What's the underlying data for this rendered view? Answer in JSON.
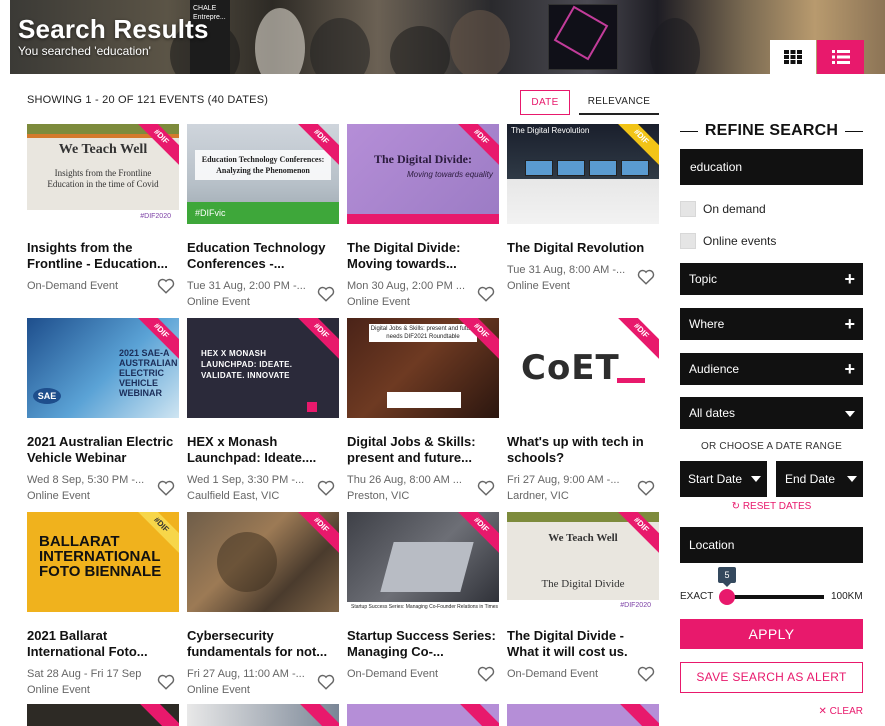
{
  "hero": {
    "title": "Search Results",
    "subtitle": "You searched 'education'",
    "sign_text": "CHALE Entrepre...",
    "view_grid_icon": "grid-icon",
    "view_list_icon": "list-icon"
  },
  "results": {
    "showing": "SHOWING 1 - 20 OF 121 EVENTS (40 DATES)",
    "sort_date": "DATE",
    "sort_relevance": "RELEVANCE"
  },
  "events": [
    {
      "title": "Insights from the Frontline - Education...",
      "meta1": "On-Demand Event",
      "meta2": "",
      "ribbon": "#DIF",
      "thumb_h1": "We Teach Well",
      "thumb_h2": "Insights from the Frontline Education in the time of Covid",
      "thumb_foot": "#DIF2020"
    },
    {
      "title": "Education Technology Conferences -...",
      "meta1": "Tue 31 Aug, 2:00 PM -...",
      "meta2": "Online Event",
      "ribbon": "#DIF",
      "thumb_h1": "Education Technology Conferences: Analyzing the Phenomenon",
      "thumb_foot": "#DIFvic"
    },
    {
      "title": "The Digital Divide: Moving towards...",
      "meta1": "Mon 30 Aug, 2:00 PM ...",
      "meta2": "Online Event",
      "ribbon": "#DIF",
      "thumb_h1": "The Digital Divide:",
      "thumb_h2": "Moving towards equality"
    },
    {
      "title": "The Digital Revolution",
      "meta1": "Tue 31 Aug, 8:00 AM -...",
      "meta2": "Online Event",
      "ribbon": "#DIF",
      "thumb_h1": "The Digital Revolution"
    },
    {
      "title": "2021 Australian Electric Vehicle Webinar",
      "meta1": "Wed 8 Sep, 5:30 PM -...",
      "meta2": "Online Event",
      "ribbon": "#DIF",
      "thumb_h1": "2021 SAE-A AUSTRALIAN ELECTRIC VEHICLE WEBINAR"
    },
    {
      "title": "HEX x Monash Launchpad: Ideate....",
      "meta1": "Wed 1 Sep, 3:30 PM -...",
      "meta2": "Caulfield East, VIC",
      "ribbon": "#DIF",
      "thumb_h1": "HEX X MONASH LAUNCHPAD: IDEATE. VALIDATE. INNOVATE"
    },
    {
      "title": "Digital Jobs & Skills: present and future...",
      "meta1": "Thu 26 Aug, 8:00 AM ...",
      "meta2": "Preston, VIC",
      "ribbon": "#DIF",
      "thumb_h1": "Digital Jobs & Skills: present and future needs DIF2021 Roundtable"
    },
    {
      "title": "What's up with tech in schools?",
      "meta1": "Fri 27 Aug, 9:00 AM -...",
      "meta2": "Lardner, VIC",
      "ribbon": "#DIF",
      "thumb_h1": "CoET"
    },
    {
      "title": "2021 Ballarat International Foto...",
      "meta1": "Sat 28 Aug - Fri 17 Sep",
      "meta2": "Online Event",
      "ribbon": "#DIF",
      "thumb_h1": "BALLARAT INTERNATIONAL FOTO BIENNALE"
    },
    {
      "title": "Cybersecurity fundamentals for not...",
      "meta1": "Fri 27 Aug, 11:00 AM -...",
      "meta2": "Online Event",
      "ribbon": "#DIF"
    },
    {
      "title": "Startup Success Series: Managing Co-...",
      "meta1": "On-Demand Event",
      "meta2": "",
      "ribbon": "#DIF",
      "thumb_foot": "Startup Success Series: Managing Co-Founder Relations in Times of Stress"
    },
    {
      "title": "The Digital Divide - What it will cost us.",
      "meta1": "On-Demand Event",
      "meta2": "",
      "ribbon": "#DIF",
      "thumb_h1": "We Teach Well",
      "thumb_h2": "The Digital Divide",
      "thumb_foot": "#DIF2020"
    }
  ],
  "refine": {
    "title": "REFINE SEARCH",
    "search_value": "education",
    "on_demand": "On demand",
    "online_events": "Online events",
    "topic": "Topic",
    "where": "Where",
    "audience": "Audience",
    "all_dates": "All dates",
    "or_choose": "OR CHOOSE A DATE RANGE",
    "start_date": "Start Date",
    "end_date": "End Date",
    "reset_dates": "RESET DATES",
    "location": "Location",
    "range_min": "EXACT",
    "range_max": "100KM",
    "range_value": "5",
    "apply": "APPLY",
    "save_alert": "SAVE SEARCH AS ALERT",
    "clear": "CLEAR"
  },
  "colors": {
    "accent": "#e8196c",
    "dark": "#111111"
  }
}
